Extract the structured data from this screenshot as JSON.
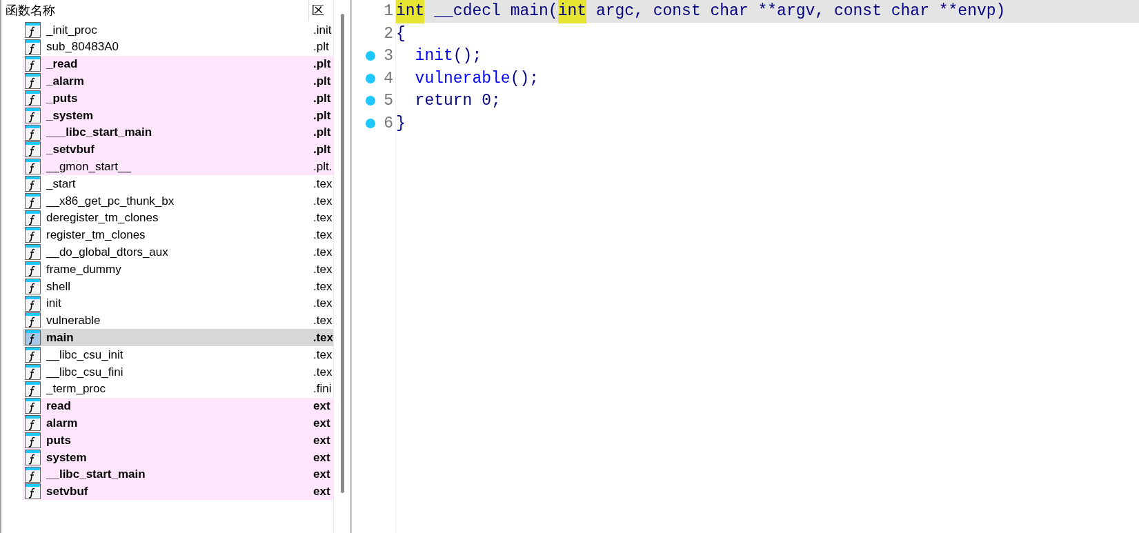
{
  "function_list": {
    "columns": [
      "函数名称",
      "区"
    ],
    "rows": [
      {
        "name": "_init_proc",
        "section": ".init",
        "imported": false,
        "selected": false
      },
      {
        "name": "sub_80483A0",
        "section": ".plt",
        "imported": false,
        "selected": false
      },
      {
        "name": "_read",
        "section": ".plt",
        "imported": true,
        "selected": false
      },
      {
        "name": "_alarm",
        "section": ".plt",
        "imported": true,
        "selected": false
      },
      {
        "name": "_puts",
        "section": ".plt",
        "imported": true,
        "selected": false
      },
      {
        "name": "_system",
        "section": ".plt",
        "imported": true,
        "selected": false
      },
      {
        "name": "___libc_start_main",
        "section": ".plt",
        "imported": true,
        "selected": false
      },
      {
        "name": "_setvbuf",
        "section": ".plt",
        "imported": true,
        "selected": false
      },
      {
        "name": "__gmon_start__",
        "section": ".plt.",
        "imported": true,
        "bold": false,
        "selected": false
      },
      {
        "name": "_start",
        "section": ".tex",
        "imported": false,
        "selected": false
      },
      {
        "name": "__x86_get_pc_thunk_bx",
        "section": ".tex",
        "imported": false,
        "selected": false
      },
      {
        "name": "deregister_tm_clones",
        "section": ".tex",
        "imported": false,
        "selected": false
      },
      {
        "name": "register_tm_clones",
        "section": ".tex",
        "imported": false,
        "selected": false
      },
      {
        "name": "__do_global_dtors_aux",
        "section": ".tex",
        "imported": false,
        "selected": false
      },
      {
        "name": "frame_dummy",
        "section": ".tex",
        "imported": false,
        "selected": false
      },
      {
        "name": "shell",
        "section": ".tex",
        "imported": false,
        "selected": false
      },
      {
        "name": "init",
        "section": ".tex",
        "imported": false,
        "selected": false
      },
      {
        "name": "vulnerable",
        "section": ".tex",
        "imported": false,
        "selected": false
      },
      {
        "name": "main",
        "section": ".tex",
        "imported": false,
        "selected": true
      },
      {
        "name": "__libc_csu_init",
        "section": ".tex",
        "imported": false,
        "selected": false
      },
      {
        "name": "__libc_csu_fini",
        "section": ".tex",
        "imported": false,
        "selected": false
      },
      {
        "name": "_term_proc",
        "section": ".fini",
        "imported": false,
        "selected": false
      },
      {
        "name": "read",
        "section": "ext",
        "imported": true,
        "selected": false
      },
      {
        "name": "alarm",
        "section": "ext",
        "imported": true,
        "selected": false
      },
      {
        "name": "puts",
        "section": "ext",
        "imported": true,
        "selected": false
      },
      {
        "name": "system",
        "section": "ext",
        "imported": true,
        "selected": false
      },
      {
        "name": "__libc_start_main",
        "section": "ext",
        "imported": true,
        "selected": false
      },
      {
        "name": "setvbuf",
        "section": "ext",
        "imported": true,
        "selected": false
      }
    ]
  },
  "pseudocode": {
    "lines": [
      {
        "number": "1",
        "current": true,
        "breakpoint": false,
        "tokens": [
          {
            "text": "int",
            "kind": "keyword",
            "highlighted": true
          },
          {
            "text": " __cdecl main(",
            "kind": "plain",
            "highlighted": false
          },
          {
            "text": "int",
            "kind": "keyword",
            "highlighted": true
          },
          {
            "text": " argc, const char **argv, const char **envp)",
            "kind": "plain",
            "highlighted": false
          }
        ]
      },
      {
        "number": "2",
        "current": false,
        "breakpoint": false,
        "tokens": [
          {
            "text": "{",
            "kind": "plain",
            "highlighted": false
          }
        ]
      },
      {
        "number": "3",
        "current": false,
        "breakpoint": true,
        "indented": true,
        "tokens": [
          {
            "text": "init",
            "kind": "call",
            "highlighted": false
          },
          {
            "text": "();",
            "kind": "plain",
            "highlighted": false
          }
        ]
      },
      {
        "number": "4",
        "current": false,
        "breakpoint": true,
        "indented": true,
        "tokens": [
          {
            "text": "vulnerable",
            "kind": "call",
            "highlighted": false
          },
          {
            "text": "();",
            "kind": "plain",
            "highlighted": false
          }
        ]
      },
      {
        "number": "5",
        "current": false,
        "breakpoint": true,
        "indented": true,
        "tokens": [
          {
            "text": "return 0;",
            "kind": "plain",
            "highlighted": false
          }
        ]
      },
      {
        "number": "6",
        "current": false,
        "breakpoint": true,
        "tokens": [
          {
            "text": "}",
            "kind": "plain",
            "highlighted": false
          }
        ]
      }
    ]
  }
}
